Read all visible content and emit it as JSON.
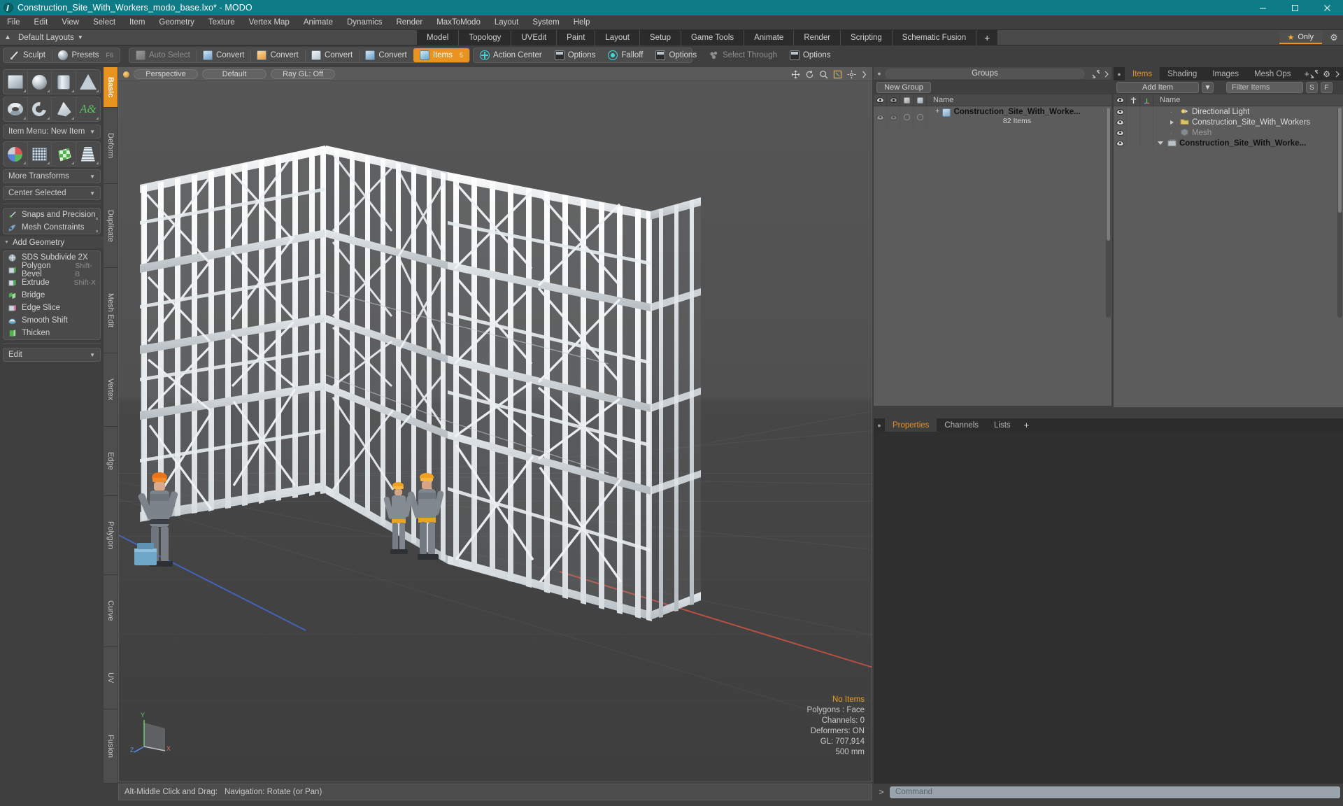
{
  "window": {
    "title": "Construction_Site_With_Workers_modo_base.lxo* - MODO",
    "app_icon": "modo-logo-icon",
    "buttons": {
      "minimize": "minimize-icon",
      "maximize": "maximize-icon",
      "close": "close-icon"
    }
  },
  "menubar": {
    "items": [
      "File",
      "Edit",
      "View",
      "Select",
      "Item",
      "Geometry",
      "Texture",
      "Vertex Map",
      "Animate",
      "Dynamics",
      "Render",
      "MaxToModo",
      "Layout",
      "System",
      "Help"
    ]
  },
  "layoutbar": {
    "preset_label": "Default Layouts",
    "tabs": [
      "Model",
      "Topology",
      "UVEdit",
      "Paint",
      "Layout",
      "Setup",
      "Game Tools",
      "Animate",
      "Render",
      "Scripting",
      "Schematic Fusion"
    ],
    "add_tab": "+",
    "only_label": "Only",
    "only_star": "★",
    "gear": "gear-icon"
  },
  "toolbar": {
    "left_group": [
      {
        "label": "Sculpt",
        "icon": "brush-icon",
        "shortcut": ""
      },
      {
        "label": "Presets",
        "icon": "sphere-icon",
        "shortcut": "F6"
      }
    ],
    "mode_group": [
      {
        "label": "Auto Select",
        "icon": "cube-grey-icon",
        "dim": true
      },
      {
        "label": "Convert",
        "icon": "cube-blue-icon",
        "dim": false
      },
      {
        "label": "Convert",
        "icon": "cube-orange-icon",
        "dim": false
      },
      {
        "label": "Convert",
        "icon": "cube-white-icon",
        "dim": false
      },
      {
        "label": "Convert",
        "icon": "cube-blue-icon",
        "dim": false
      },
      {
        "label": "Items",
        "icon": "cube-teal-icon",
        "dim": false,
        "active": true,
        "badge": "5"
      }
    ],
    "action_group": [
      {
        "label": "Action Center",
        "icon": "crosshair-icon",
        "dim": false
      },
      {
        "label": "Options",
        "icon": "options-icon",
        "dim": false
      },
      {
        "label": "Falloff",
        "icon": "falloff-icon",
        "dim": false
      },
      {
        "label": "Options",
        "icon": "options-icon",
        "dim": false
      },
      {
        "label": "Select Through",
        "icon": "select-through-icon",
        "dim": true
      },
      {
        "label": "Options",
        "icon": "options-icon",
        "dim": false
      }
    ]
  },
  "left_panel": {
    "primitive_row1": [
      "cube-icon",
      "sphere-icon",
      "cylinder-icon",
      "cone-icon"
    ],
    "primitive_row2": [
      "torus-icon",
      "spiral-icon",
      "polygon-icon",
      "text-icon"
    ],
    "item_menu": {
      "label": "Item Menu: New Item",
      "caret": "▼"
    },
    "transform_row": [
      "transform-axis-icon",
      "grid-mesh-icon",
      "checker-mesh-icon",
      "taper-mesh-icon"
    ],
    "more_transforms": {
      "label": "More Transforms",
      "caret": "▼"
    },
    "center_selected": {
      "label": "Center Selected",
      "caret": "▼"
    },
    "snaps": [
      {
        "label": "Snaps and Precision",
        "icon": "snap-arrow-icon"
      },
      {
        "label": "Mesh Constraints",
        "icon": "constraint-icon"
      }
    ],
    "add_geometry": {
      "label": "Add Geometry",
      "caret": "▼"
    },
    "geometry_tools": [
      {
        "label": "SDS Subdivide 2X",
        "icon": "subdivide-icon",
        "shortcut": ""
      },
      {
        "label": "Polygon Bevel",
        "icon": "bevel-icon",
        "shortcut": "Shift-B"
      },
      {
        "label": "Extrude",
        "icon": "extrude-icon",
        "shortcut": "Shift-X"
      },
      {
        "label": "Bridge",
        "icon": "bridge-icon",
        "shortcut": ""
      },
      {
        "label": "Edge Slice",
        "icon": "edge-slice-icon",
        "shortcut": ""
      },
      {
        "label": "Smooth Shift",
        "icon": "smooth-shift-icon",
        "shortcut": ""
      },
      {
        "label": "Thicken",
        "icon": "thicken-icon",
        "shortcut": ""
      }
    ],
    "edit_dropdown": {
      "label": "Edit",
      "caret": "▼"
    },
    "vertical_tabs": [
      "Basic",
      "Deform",
      "Duplicate",
      "Mesh Edit",
      "Vertex",
      "Edge",
      "Polygon",
      "Curve",
      "UV",
      "Fusion"
    ],
    "vertical_tab_active": "Basic"
  },
  "viewport": {
    "view_mode": "Perspective",
    "shading": "Default",
    "ray_gl": "Ray GL: Off",
    "header_icons": [
      "move-view-icon",
      "rotate-view-icon",
      "zoom-view-icon",
      "fit-view-icon",
      "options-view-icon",
      "expand-view-icon"
    ],
    "gizmo": {
      "y": "Y",
      "x": "X",
      "z": "Z"
    },
    "stats": {
      "selection": "No Items",
      "polygons": "Polygons : Face",
      "channels": "Channels: 0",
      "deformers": "Deformers: ON",
      "gl": "GL: 707,914",
      "scale": "500 mm"
    }
  },
  "groups_panel": {
    "title": "Groups",
    "new_group_button": "New Group",
    "column_headers": [
      "visible-eye-icon",
      "render-eye-icon",
      "lock-cube-icon",
      "select-cube-icon",
      "Name"
    ],
    "rows": [
      {
        "name": "Construction_Site_With_Worke...",
        "subtitle": "82 Items",
        "icon": "group-cube-icon",
        "expander": "+"
      }
    ]
  },
  "items_panel": {
    "tabs": [
      "Items",
      "Shading",
      "Images",
      "Mesh Ops"
    ],
    "active_tab": "Items",
    "add_tab": "+",
    "add_item_button": "Add Item",
    "add_item_caret": "▼",
    "filter_placeholder": "Filter Items",
    "filter_buttons": [
      "S",
      "F"
    ],
    "column_headers": [
      "visible-eye-icon",
      "lock-icon",
      "axis-icon",
      "Name"
    ],
    "rows": [
      {
        "name": "Construction_Site_With_Worke...",
        "icon": "scene-icon",
        "indent": 0,
        "expander": "down",
        "bold": true,
        "dim": false
      },
      {
        "name": "Mesh",
        "icon": "mesh-cube-icon",
        "indent": 1,
        "expander": "none",
        "bold": false,
        "dim": true
      },
      {
        "name": "Construction_Site_With_Workers",
        "icon": "folder-icon",
        "indent": 1,
        "expander": "right",
        "bold": false,
        "dim": false
      },
      {
        "name": "Directional Light",
        "icon": "light-icon",
        "indent": 1,
        "expander": "none",
        "bold": false,
        "dim": false
      }
    ]
  },
  "properties_panel": {
    "tabs": [
      "Properties",
      "Channels",
      "Lists"
    ],
    "active_tab": "Properties",
    "add_tab": "+"
  },
  "status": {
    "hint_key": "Alt-Middle Click and Drag:",
    "hint_action": "Navigation: Rotate (or Pan)",
    "command_arrow": ">",
    "command_placeholder": "Command"
  },
  "colors": {
    "accent_orange": "#e8931f",
    "title_teal": "#0e7c86",
    "panel_bg": "#3f3f3f",
    "tree_bg": "#5c5c5c"
  }
}
